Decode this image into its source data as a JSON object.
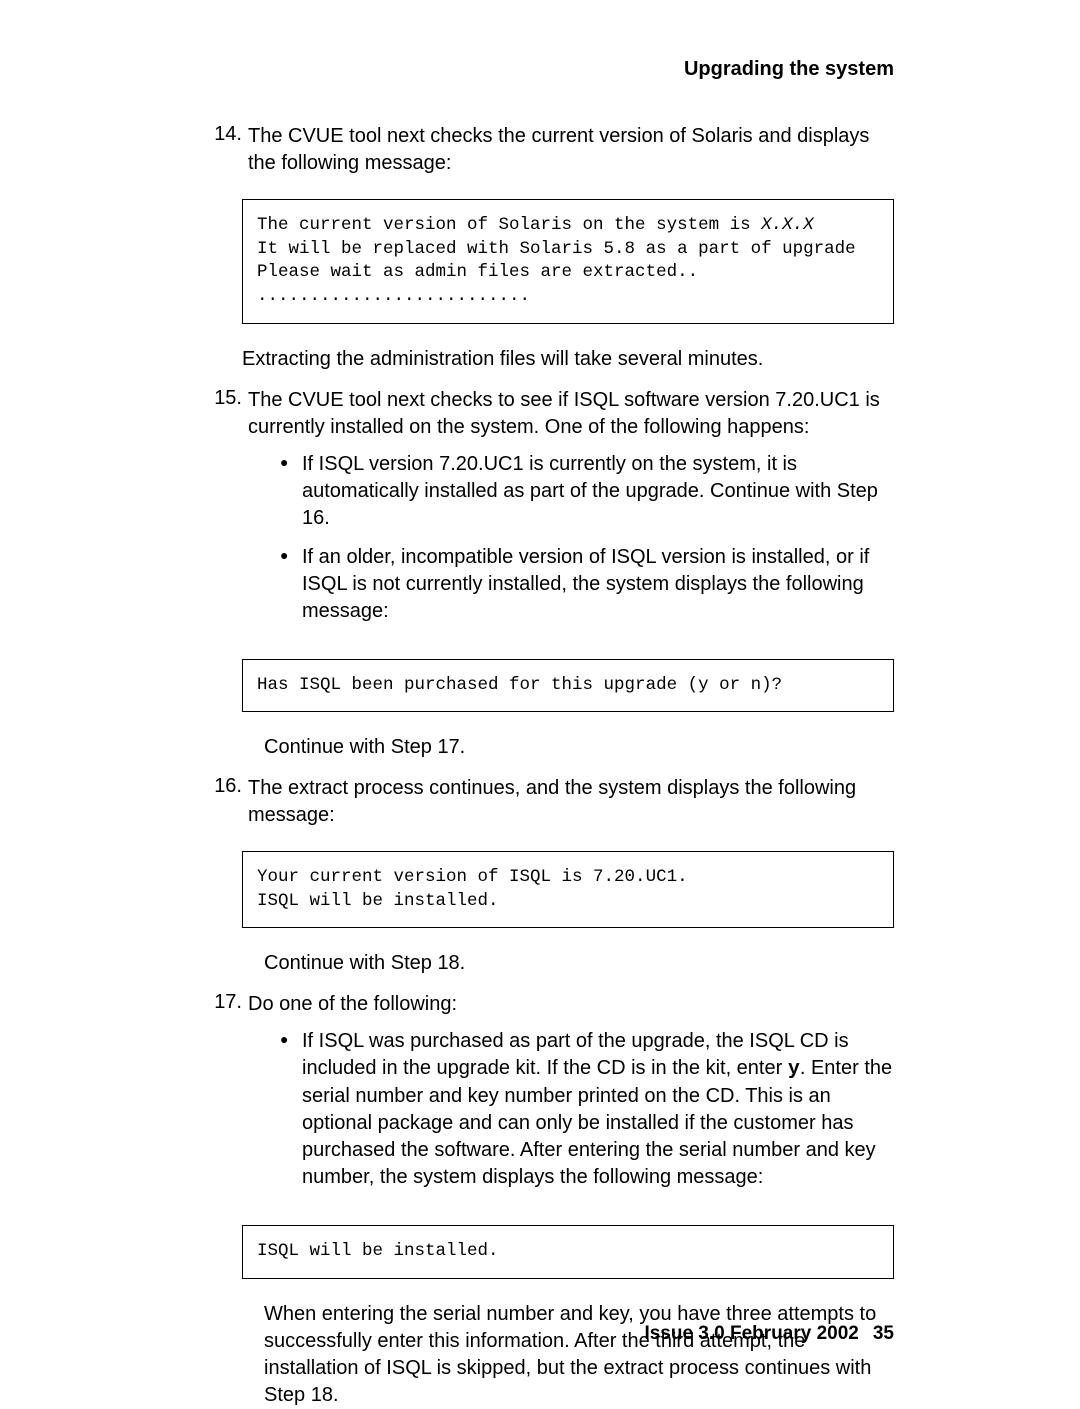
{
  "header": {
    "title": "Upgrading the system"
  },
  "steps": {
    "s14": {
      "num": "14.",
      "text": "The CVUE tool next checks the current version of Solaris and displays the following message:",
      "code_line1a": "The current version of Solaris on the system is ",
      "code_line1b": "X.X.X",
      "code_line2": "It will be replaced with Solaris 5.8 as a part of upgrade",
      "code_line3": "Please wait as admin files are extracted..",
      "code_line4": "..........................",
      "after": "Extracting the administration files will take several minutes."
    },
    "s15": {
      "num": "15.",
      "text": "The CVUE tool next checks to see if ISQL software version 7.20.UC1 is currently installed on the system. One of the following happens:",
      "b1": "If ISQL version 7.20.UC1 is currently on the system, it is automatically installed as part of the upgrade. Continue with Step 16.",
      "b2": "If an older, incompatible version of ISQL version is installed, or if ISQL is not currently installed, the system displays the following message:",
      "code": "Has ISQL been purchased for this upgrade (y or n)?",
      "continue": "Continue with Step 17."
    },
    "s16": {
      "num": "16.",
      "text": "The extract process continues, and the system displays the following message:",
      "code_line1": "Your current version of ISQL is 7.20.UC1.",
      "code_line2": "ISQL will be installed.",
      "continue": "Continue with Step 18."
    },
    "s17": {
      "num": "17.",
      "text": "Do one of the following:",
      "b1a": "If ISQL was purchased as part of the upgrade, the ISQL CD is included in the upgrade kit. If the CD is in the kit, enter ",
      "b1_y": "y",
      "b1b": ". Enter the serial number and key number printed on the CD. This is an optional package and can only be installed if the customer has purchased the software. After entering the serial number and key number, the system displays the following message:",
      "code": "ISQL will be installed.",
      "after": "When entering the serial number and key, you have three attempts to successfully enter this information. After the third attempt, the installation of ISQL is skipped, but the extract process continues with Step 18."
    }
  },
  "footer": {
    "issue": "Issue 3.0   February 2002",
    "page": "35"
  }
}
